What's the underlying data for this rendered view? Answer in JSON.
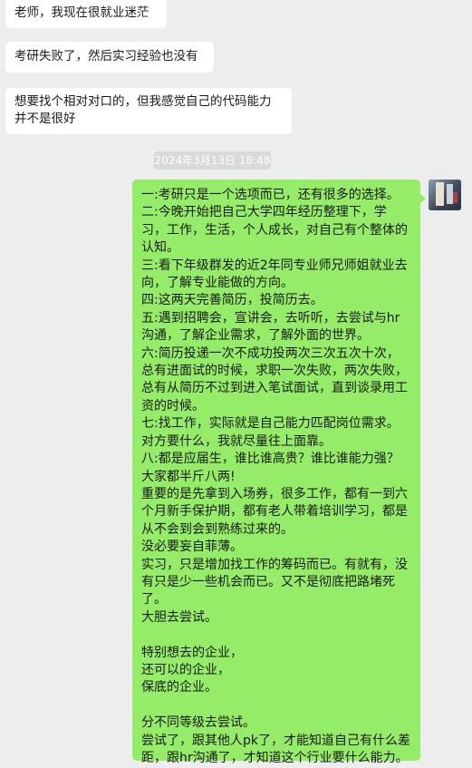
{
  "messages": [
    {
      "direction": "in",
      "text": "老师，我现在很就业迷茫"
    },
    {
      "direction": "in",
      "text": "考研失败了，然后实习经验也没有"
    },
    {
      "direction": "in",
      "text": "想要找个相对对口的，但我感觉自己的代码能力并不是很好"
    }
  ],
  "timestamp": "2024年3月13日 18:48",
  "reply": {
    "direction": "out",
    "text": "一:考研只是一个选项而已，还有很多的选择。\n二:今晚开始把自己大学四年经历整理下，学习，工作，生活，个人成长，对自己有个整体的认知。\n三:看下年级群发的近2年同专业师兄师姐就业去向，了解专业能做的方向。\n四:这两天完善简历，投简历去。\n五:遇到招聘会，宣讲会，去听听，去尝试与hr沟通，了解企业需求，了解外面的世界。\n六:简历投递一次不成功投两次三次五次十次，总有进面试的时候，求职一次失败，两次失败，总有从简历不过到进入笔试面试，直到谈录用工资的时候。\n七:找工作，实际就是自己能力匹配岗位需求。对方要什么，我就尽量往上面靠。\n八:都是应届生，谁比谁高贵？谁比谁能力强？大家都半斤八两!\n重要的是先拿到入场券，很多工作，都有一到六个月新手保护期，都有老人带着培训学习，都是从不会到会到熟练过来的。\n没必要妄自菲薄。\n实习，只是增加找工作的筹码而已。有就有，没有只是少一些机会而已。又不是彻底把路堵死了。\n大胆去尝试。\n\n特别想去的企业，\n还可以的企业，\n保底的企业。\n\n分不同等级去尝试。\n尝试了，跟其他人pk了，才能知道自己有什么差距，跟hr沟通了，才知道这个行业要什么能力。"
  },
  "colors": {
    "background": "#ededed",
    "incoming_bubble": "#ffffff",
    "outgoing_bubble": "#95ec69",
    "timestamp_bg": "#dadada"
  }
}
